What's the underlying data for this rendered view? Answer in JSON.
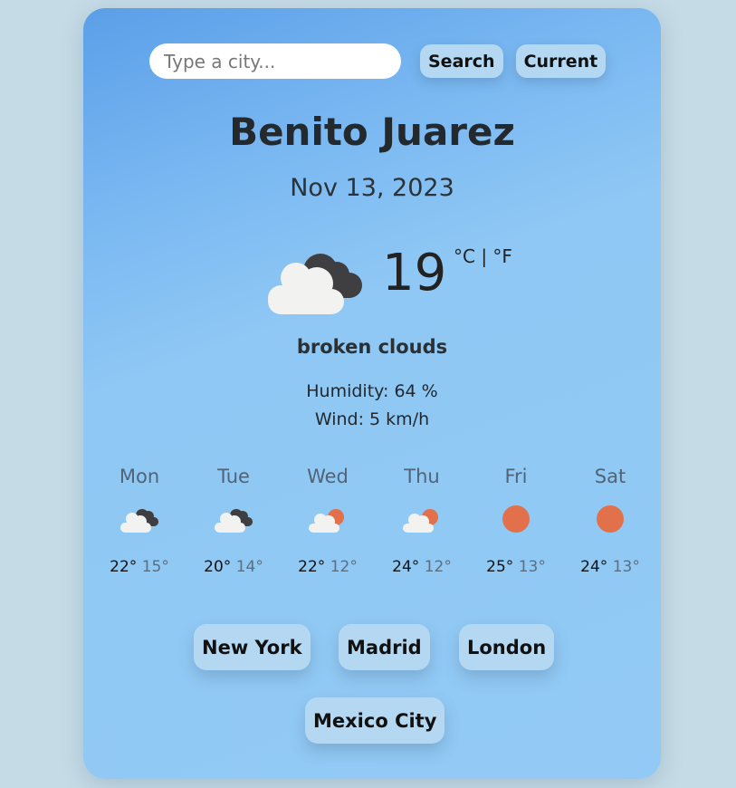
{
  "search": {
    "placeholder": "Type a city...",
    "value": ""
  },
  "toolbar": {
    "search_label": "Search",
    "current_label": "Current"
  },
  "weather": {
    "city": "Benito Juarez",
    "date": "Nov 13, 2023",
    "icon": "broken-clouds-icon",
    "temperature": "19",
    "units": "°C | °F",
    "description": "broken clouds",
    "humidity": "Humidity: 64 %",
    "wind": "Wind: 5 km/h"
  },
  "forecast": [
    {
      "day": "Mon",
      "icon": "broken-clouds-icon",
      "max": "22°",
      "min": "15°"
    },
    {
      "day": "Tue",
      "icon": "broken-clouds-icon",
      "max": "20°",
      "min": "14°"
    },
    {
      "day": "Wed",
      "icon": "few-clouds-icon",
      "max": "22°",
      "min": "12°"
    },
    {
      "day": "Thu",
      "icon": "few-clouds-icon",
      "max": "24°",
      "min": "12°"
    },
    {
      "day": "Fri",
      "icon": "sun-icon",
      "max": "25°",
      "min": "13°"
    },
    {
      "day": "Sat",
      "icon": "sun-icon",
      "max": "24°",
      "min": "13°"
    }
  ],
  "quick_cities": [
    "New York",
    "Madrid",
    "London",
    "Mexico City"
  ],
  "colors": {
    "background": "#c5dbe6",
    "card_gradient_start": "#5b9fe8",
    "card_gradient_end": "#92caf5",
    "button": "#b5d8f2",
    "sun": "#e2704a",
    "dark_cloud": "#3f3f42",
    "light_cloud": "#f2f2f0"
  }
}
